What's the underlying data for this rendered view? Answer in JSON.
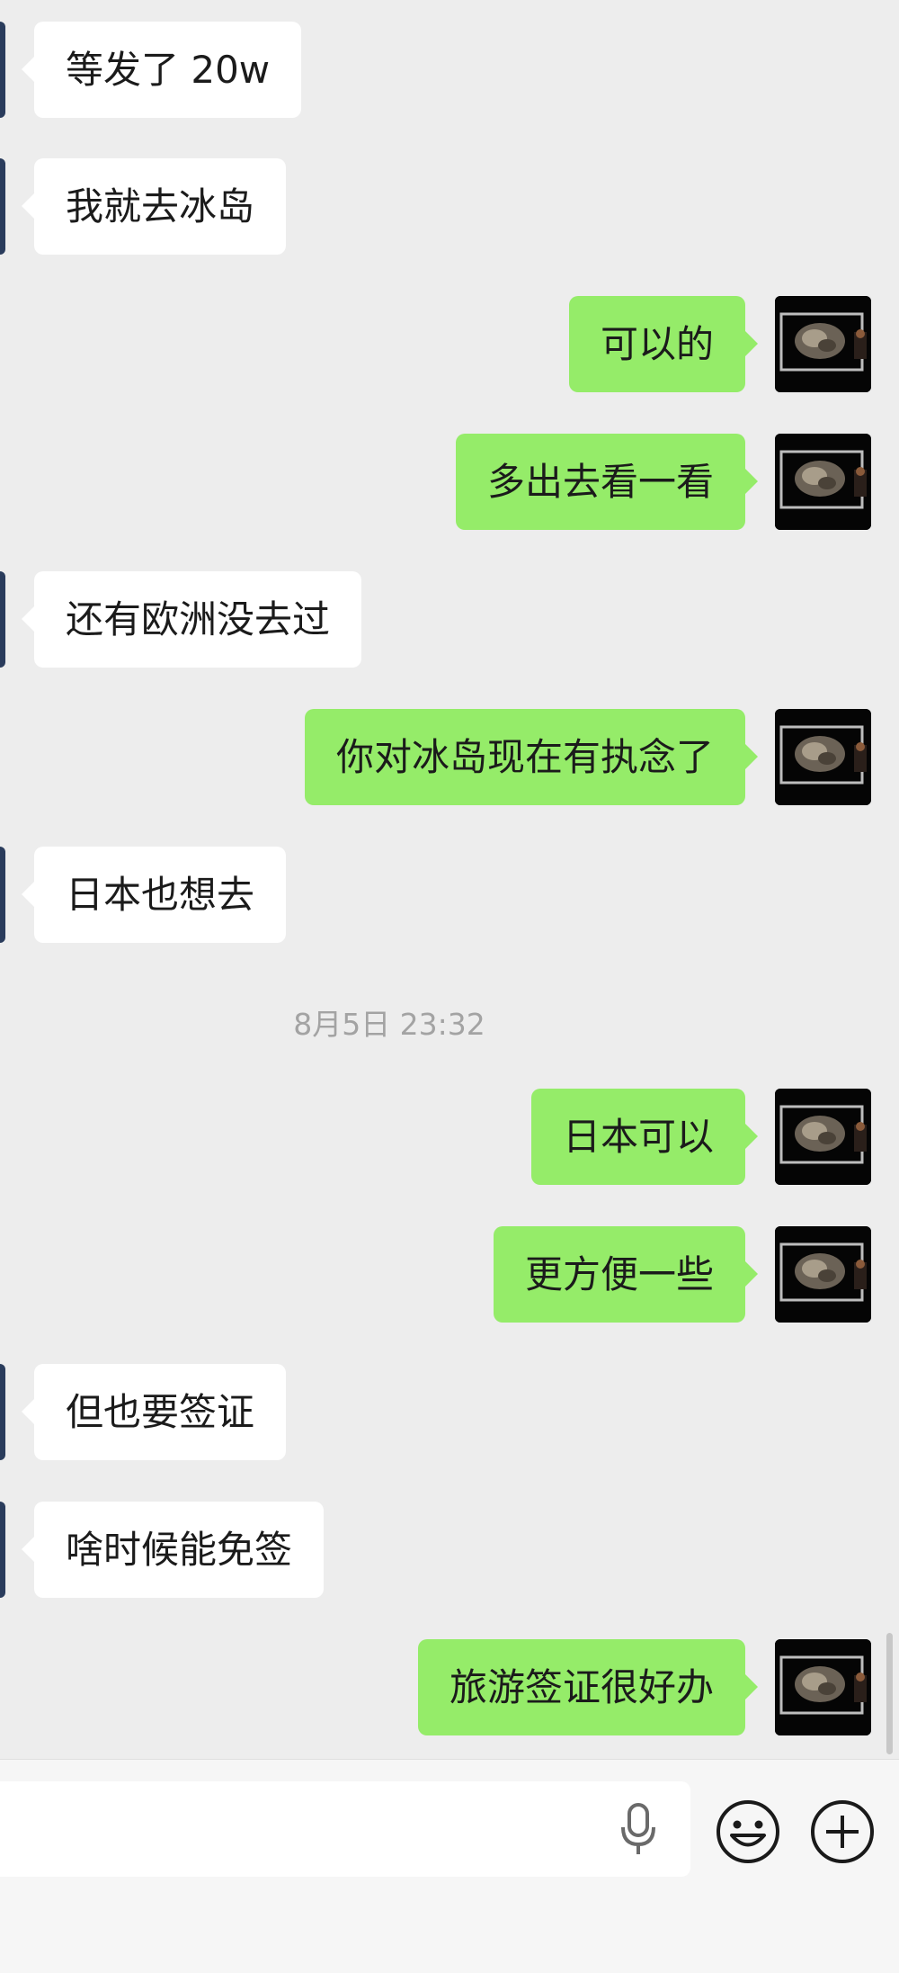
{
  "messages": [
    {
      "direction": "in",
      "text": "等发了 20w"
    },
    {
      "direction": "in",
      "text": "我就去冰岛"
    },
    {
      "direction": "out",
      "text": "可以的"
    },
    {
      "direction": "out",
      "text": "多出去看一看"
    },
    {
      "direction": "in",
      "text": "还有欧洲没去过"
    },
    {
      "direction": "out",
      "text": "你对冰岛现在有执念了"
    },
    {
      "direction": "in",
      "text": "日本也想去"
    },
    {
      "direction": "out",
      "text": "日本可以"
    },
    {
      "direction": "out",
      "text": "更方便一些"
    },
    {
      "direction": "in",
      "text": "但也要签证"
    },
    {
      "direction": "in",
      "text": "啥时候能免签"
    },
    {
      "direction": "out",
      "text": "旅游签证很好办"
    }
  ],
  "timestamp": "8月5日 23:32",
  "input_bar": {
    "voice_icon": "microphone-icon",
    "emoji_icon": "smiley-icon",
    "add_icon": "plus-circle-icon"
  },
  "colors": {
    "background": "#ededed",
    "outgoing_bubble": "#95ec69",
    "incoming_bubble": "#ffffff",
    "timestamp_text": "#a3a3a3"
  }
}
